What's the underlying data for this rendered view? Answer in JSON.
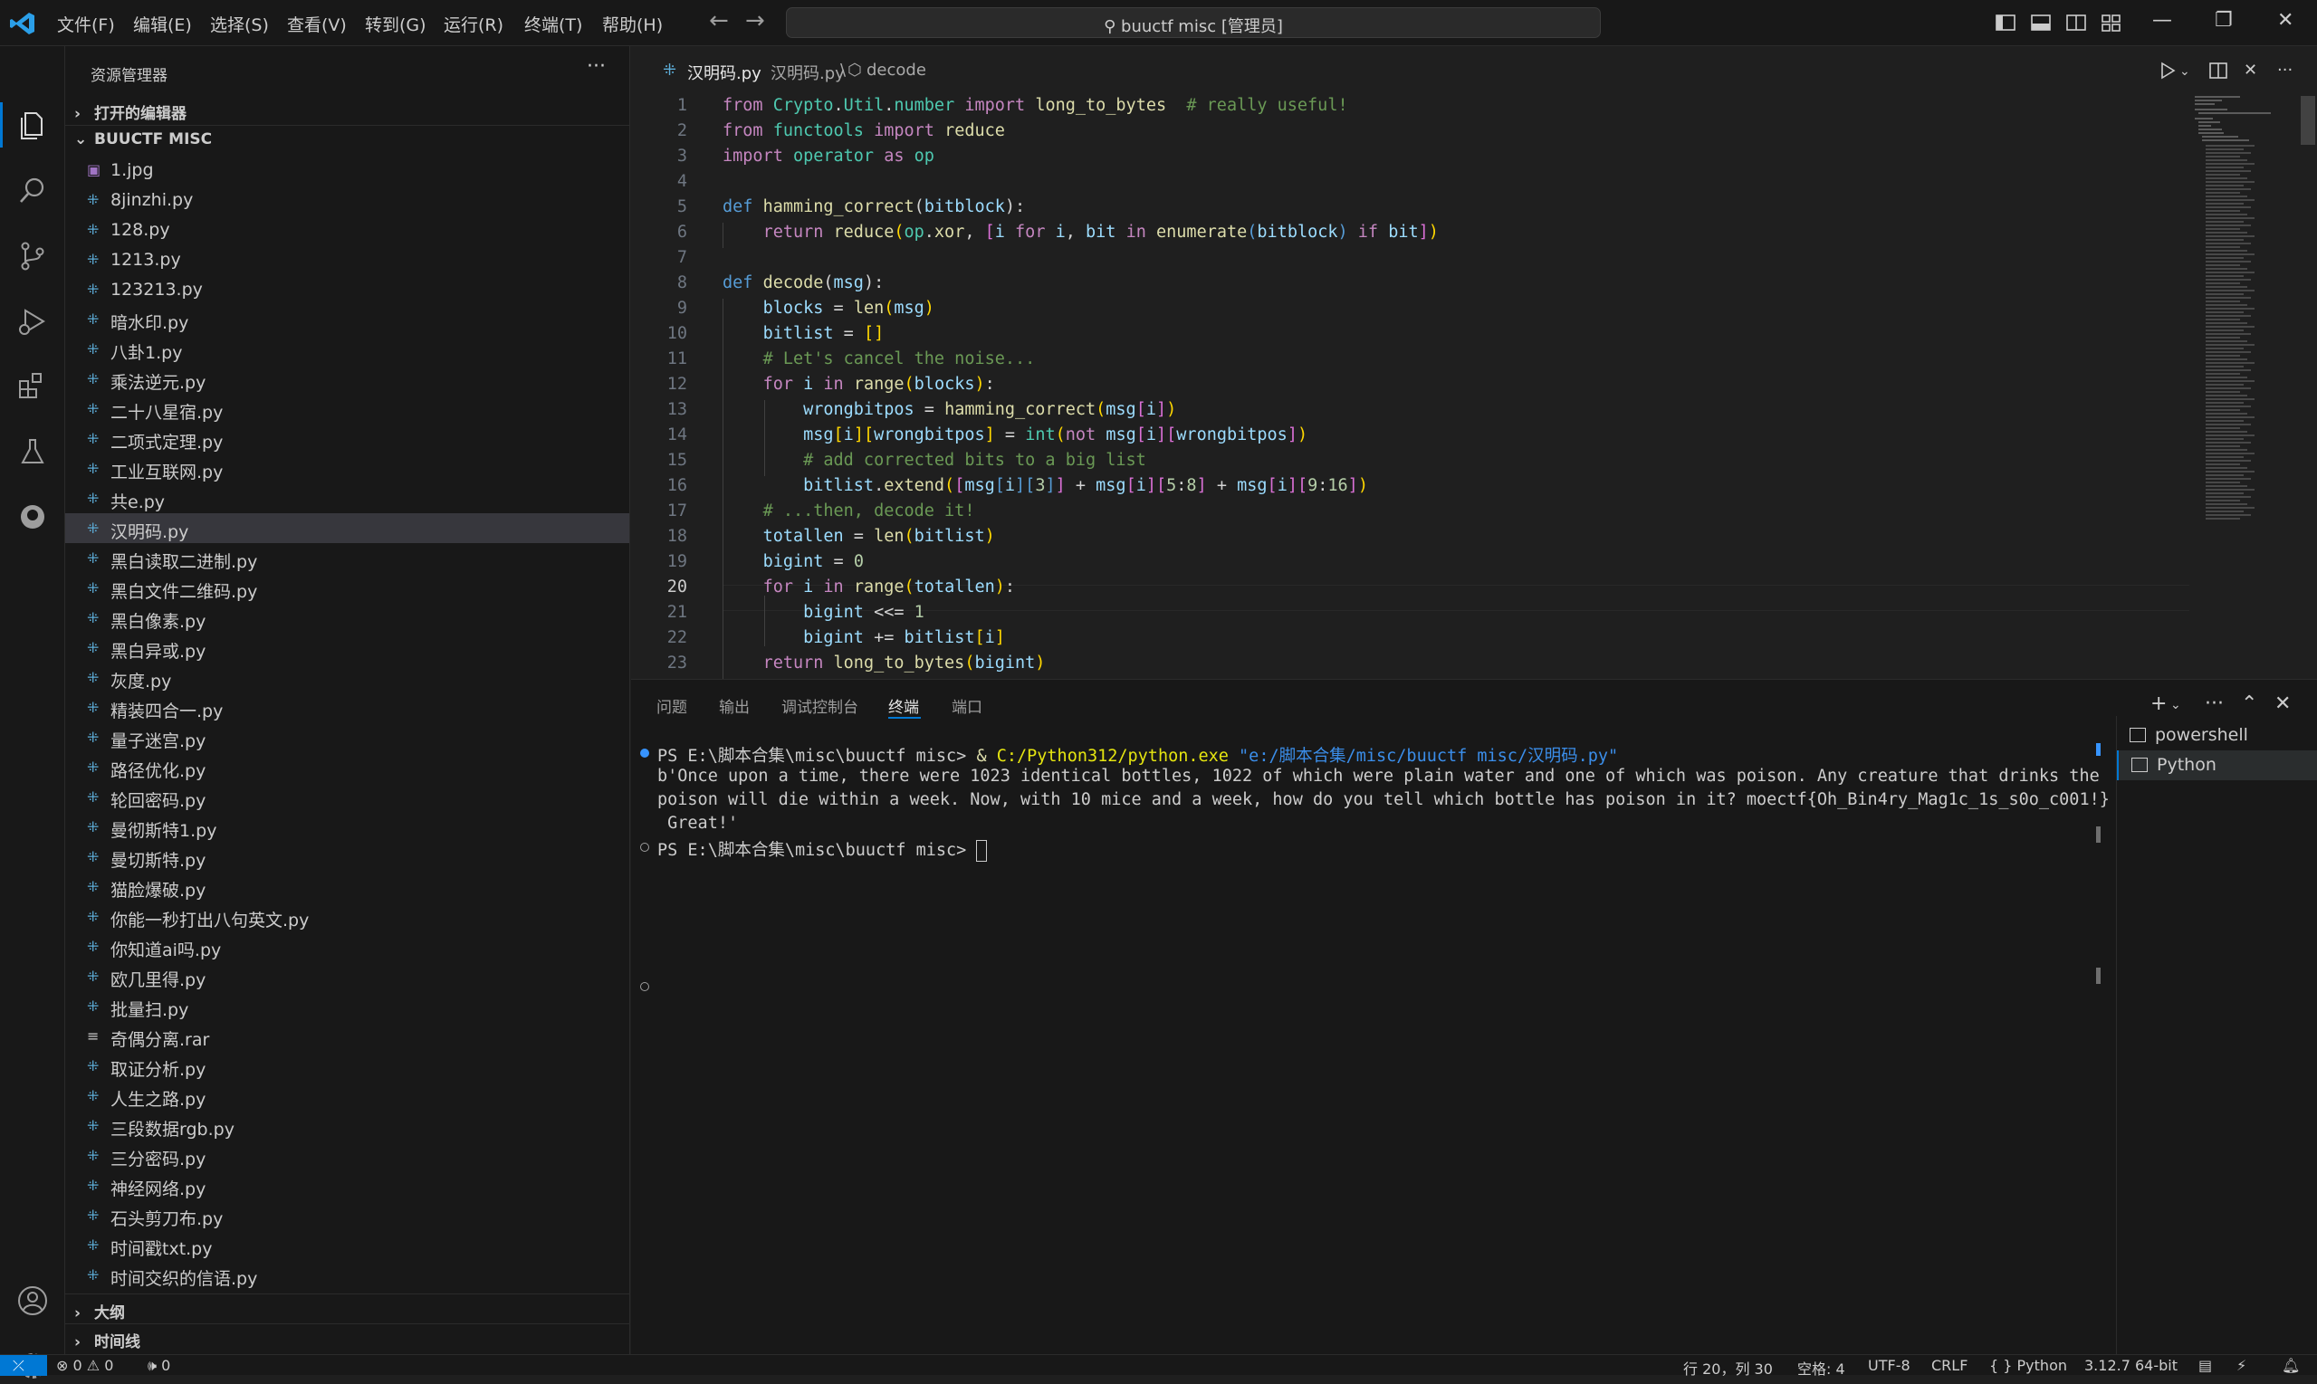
{
  "titlebar": {
    "menu": [
      "文件(F)",
      "编辑(E)",
      "选择(S)",
      "查看(V)",
      "转到(G)",
      "运行(R)",
      "终端(T)",
      "帮助(H)"
    ],
    "search_text": "buuctf misc [管理员]"
  },
  "sidebar": {
    "title": "资源管理器",
    "open_editors": "打开的编辑器",
    "folder": "BUUCTF MISC",
    "files": [
      "1.jpg",
      "8jinzhi.py",
      "128.py",
      "1213.py",
      "123213.py",
      "暗水印.py",
      "八卦1.py",
      "乘法逆元.py",
      "二十八星宿.py",
      "二项式定理.py",
      "工业互联网.py",
      "共e.py",
      "汉明码.py",
      "黑白读取二进制.py",
      "黑白文件二维码.py",
      "黑白像素.py",
      "黑白异或.py",
      "灰度.py",
      "精装四合一.py",
      "量子迷宫.py",
      "路径优化.py",
      "轮回密码.py",
      "曼彻斯特1.py",
      "曼切斯特.py",
      "猫脸爆破.py",
      "你能一秒打出八句英文.py",
      "你知道ai吗.py",
      "欧几里得.py",
      "批量扫.py",
      "奇偶分离.rar",
      "取证分析.py",
      "人生之路.py",
      "三段数据rgb.py",
      "三分密码.py",
      "神经网络.py",
      "石头剪刀布.py",
      "时间戳txt.py",
      "时间交织的信语.py"
    ],
    "outline": "大纲",
    "timeline": "时间线"
  },
  "editor": {
    "tab_name": "汉明码.py",
    "breadcrumb_file": "汉明码.py",
    "breadcrumb_symbol": "decode",
    "current_line": 20,
    "line_numbers": [
      "1",
      "2",
      "3",
      "4",
      "5",
      "6",
      "7",
      "8",
      "9",
      "10",
      "11",
      "12",
      "13",
      "14",
      "15",
      "16",
      "17",
      "18",
      "19",
      "20",
      "21",
      "22",
      "23"
    ]
  },
  "panel": {
    "tabs": [
      "问题",
      "输出",
      "调试控制台",
      "终端",
      "端口"
    ],
    "active_tab": "终端",
    "terminal": {
      "prompt1": "PS E:\\脚本合集\\misc\\buuctf misc> ",
      "cmd_amp": "& ",
      "cmd_exe": "C:/Python312/python.exe ",
      "cmd_arg": "\"e:/脚本合集/misc/buuctf misc/汉明码.py\"",
      "out1": "b'Once upon a time, there were 1023 identical bottles, 1022 of which were plain water and one of which was poison. Any creature that drinks the",
      "out2": "poison will die within a week. Now, with 10 mice and a week, how do you tell which bottle has poison in it? moectf{Oh_Bin4ry_Mag1c_1s_s0o_c001!}",
      "out3": " Great!'",
      "prompt2": "PS E:\\脚本合集\\misc\\buuctf misc> "
    },
    "terminal_list": [
      "powershell",
      "Python"
    ]
  },
  "statusbar": {
    "problems": "⊗ 0 ⚠ 0",
    "ports": "🕪 0",
    "position": "行 20，列 30",
    "spaces": "空格: 4",
    "encoding": "UTF-8",
    "eol": "CRLF",
    "language": "{ } Python",
    "interpreter": "3.12.7 64-bit"
  },
  "colors": {
    "accent": "#0078d4",
    "background": "#1f1f1f",
    "sidebar": "#181818"
  }
}
